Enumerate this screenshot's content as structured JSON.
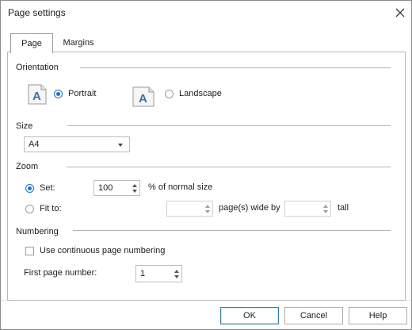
{
  "dialog": {
    "title": "Page settings"
  },
  "tabs": [
    {
      "label": "Page",
      "selected": true
    },
    {
      "label": "Margins",
      "selected": false
    }
  ],
  "orientation": {
    "heading": "Orientation",
    "portrait": {
      "label": "Portrait",
      "selected": true,
      "icon_letter": "A"
    },
    "landscape": {
      "label": "Landscape",
      "selected": false,
      "icon_letter": "A"
    }
  },
  "size": {
    "heading": "Size",
    "selected": "A4"
  },
  "zoom": {
    "heading": "Zoom",
    "set": {
      "label": "Set:",
      "selected": true,
      "value": "100",
      "suffix": "% of normal size"
    },
    "fit": {
      "label": "Fit to:",
      "selected": false,
      "wide_value": "",
      "wide_suffix": "page(s) wide by",
      "tall_value": "",
      "tall_suffix": "tall"
    }
  },
  "numbering": {
    "heading": "Numbering",
    "continuous": {
      "label": "Use continuous page numbering",
      "checked": false
    },
    "first_page": {
      "label": "First page number:",
      "value": "1"
    }
  },
  "buttons": {
    "ok": "OK",
    "cancel": "Cancel",
    "help": "Help"
  },
  "colors": {
    "accent": "#1a73c8",
    "icon_letter": "#3a6fb0"
  }
}
